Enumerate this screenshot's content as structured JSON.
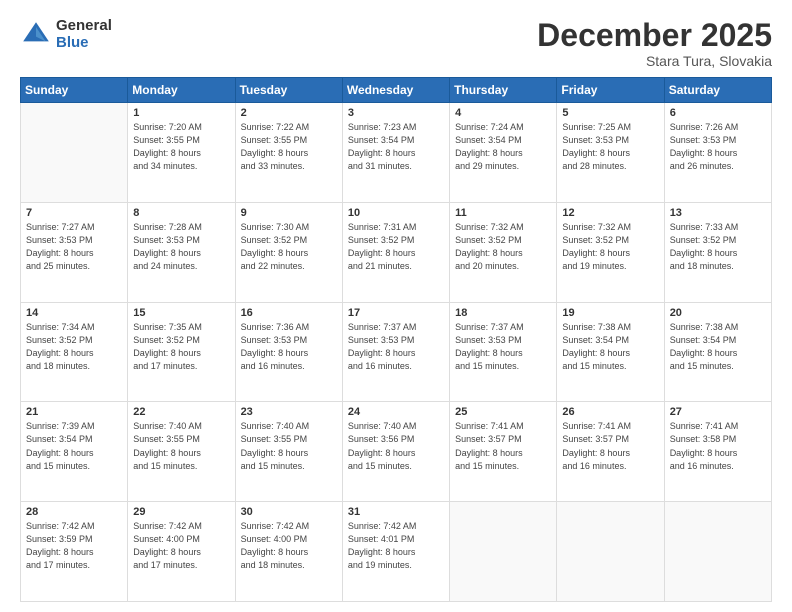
{
  "logo": {
    "general": "General",
    "blue": "Blue"
  },
  "header": {
    "title": "December 2025",
    "subtitle": "Stara Tura, Slovakia"
  },
  "calendar": {
    "days_of_week": [
      "Sunday",
      "Monday",
      "Tuesday",
      "Wednesday",
      "Thursday",
      "Friday",
      "Saturday"
    ],
    "weeks": [
      [
        {
          "day": "",
          "info": ""
        },
        {
          "day": "1",
          "info": "Sunrise: 7:20 AM\nSunset: 3:55 PM\nDaylight: 8 hours\nand 34 minutes."
        },
        {
          "day": "2",
          "info": "Sunrise: 7:22 AM\nSunset: 3:55 PM\nDaylight: 8 hours\nand 33 minutes."
        },
        {
          "day": "3",
          "info": "Sunrise: 7:23 AM\nSunset: 3:54 PM\nDaylight: 8 hours\nand 31 minutes."
        },
        {
          "day": "4",
          "info": "Sunrise: 7:24 AM\nSunset: 3:54 PM\nDaylight: 8 hours\nand 29 minutes."
        },
        {
          "day": "5",
          "info": "Sunrise: 7:25 AM\nSunset: 3:53 PM\nDaylight: 8 hours\nand 28 minutes."
        },
        {
          "day": "6",
          "info": "Sunrise: 7:26 AM\nSunset: 3:53 PM\nDaylight: 8 hours\nand 26 minutes."
        }
      ],
      [
        {
          "day": "7",
          "info": "Sunrise: 7:27 AM\nSunset: 3:53 PM\nDaylight: 8 hours\nand 25 minutes."
        },
        {
          "day": "8",
          "info": "Sunrise: 7:28 AM\nSunset: 3:53 PM\nDaylight: 8 hours\nand 24 minutes."
        },
        {
          "day": "9",
          "info": "Sunrise: 7:30 AM\nSunset: 3:52 PM\nDaylight: 8 hours\nand 22 minutes."
        },
        {
          "day": "10",
          "info": "Sunrise: 7:31 AM\nSunset: 3:52 PM\nDaylight: 8 hours\nand 21 minutes."
        },
        {
          "day": "11",
          "info": "Sunrise: 7:32 AM\nSunset: 3:52 PM\nDaylight: 8 hours\nand 20 minutes."
        },
        {
          "day": "12",
          "info": "Sunrise: 7:32 AM\nSunset: 3:52 PM\nDaylight: 8 hours\nand 19 minutes."
        },
        {
          "day": "13",
          "info": "Sunrise: 7:33 AM\nSunset: 3:52 PM\nDaylight: 8 hours\nand 18 minutes."
        }
      ],
      [
        {
          "day": "14",
          "info": "Sunrise: 7:34 AM\nSunset: 3:52 PM\nDaylight: 8 hours\nand 18 minutes."
        },
        {
          "day": "15",
          "info": "Sunrise: 7:35 AM\nSunset: 3:52 PM\nDaylight: 8 hours\nand 17 minutes."
        },
        {
          "day": "16",
          "info": "Sunrise: 7:36 AM\nSunset: 3:53 PM\nDaylight: 8 hours\nand 16 minutes."
        },
        {
          "day": "17",
          "info": "Sunrise: 7:37 AM\nSunset: 3:53 PM\nDaylight: 8 hours\nand 16 minutes."
        },
        {
          "day": "18",
          "info": "Sunrise: 7:37 AM\nSunset: 3:53 PM\nDaylight: 8 hours\nand 15 minutes."
        },
        {
          "day": "19",
          "info": "Sunrise: 7:38 AM\nSunset: 3:54 PM\nDaylight: 8 hours\nand 15 minutes."
        },
        {
          "day": "20",
          "info": "Sunrise: 7:38 AM\nSunset: 3:54 PM\nDaylight: 8 hours\nand 15 minutes."
        }
      ],
      [
        {
          "day": "21",
          "info": "Sunrise: 7:39 AM\nSunset: 3:54 PM\nDaylight: 8 hours\nand 15 minutes."
        },
        {
          "day": "22",
          "info": "Sunrise: 7:40 AM\nSunset: 3:55 PM\nDaylight: 8 hours\nand 15 minutes."
        },
        {
          "day": "23",
          "info": "Sunrise: 7:40 AM\nSunset: 3:55 PM\nDaylight: 8 hours\nand 15 minutes."
        },
        {
          "day": "24",
          "info": "Sunrise: 7:40 AM\nSunset: 3:56 PM\nDaylight: 8 hours\nand 15 minutes."
        },
        {
          "day": "25",
          "info": "Sunrise: 7:41 AM\nSunset: 3:57 PM\nDaylight: 8 hours\nand 15 minutes."
        },
        {
          "day": "26",
          "info": "Sunrise: 7:41 AM\nSunset: 3:57 PM\nDaylight: 8 hours\nand 16 minutes."
        },
        {
          "day": "27",
          "info": "Sunrise: 7:41 AM\nSunset: 3:58 PM\nDaylight: 8 hours\nand 16 minutes."
        }
      ],
      [
        {
          "day": "28",
          "info": "Sunrise: 7:42 AM\nSunset: 3:59 PM\nDaylight: 8 hours\nand 17 minutes."
        },
        {
          "day": "29",
          "info": "Sunrise: 7:42 AM\nSunset: 4:00 PM\nDaylight: 8 hours\nand 17 minutes."
        },
        {
          "day": "30",
          "info": "Sunrise: 7:42 AM\nSunset: 4:00 PM\nDaylight: 8 hours\nand 18 minutes."
        },
        {
          "day": "31",
          "info": "Sunrise: 7:42 AM\nSunset: 4:01 PM\nDaylight: 8 hours\nand 19 minutes."
        },
        {
          "day": "",
          "info": ""
        },
        {
          "day": "",
          "info": ""
        },
        {
          "day": "",
          "info": ""
        }
      ]
    ]
  }
}
